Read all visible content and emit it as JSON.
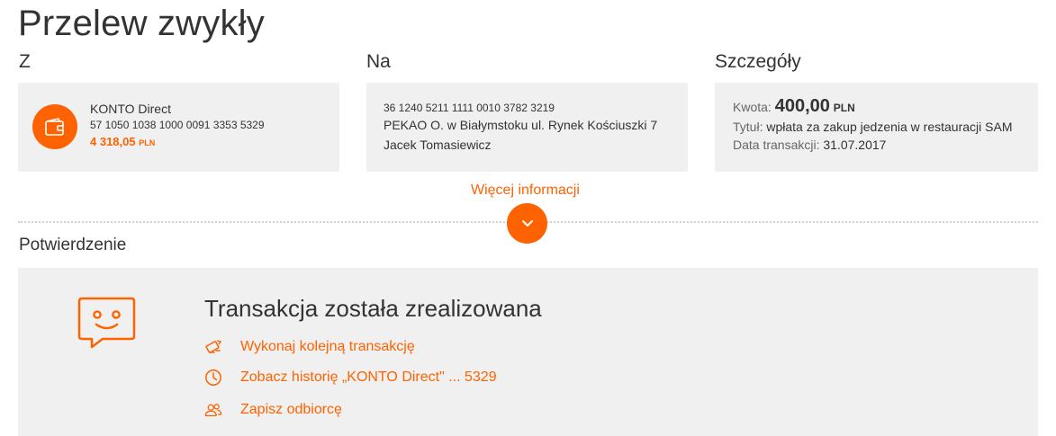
{
  "page": {
    "title": "Przelew zwykły"
  },
  "columns": {
    "from": "Z",
    "to": "Na",
    "details": "Szczegóły"
  },
  "from_account": {
    "name": "KONTO Direct",
    "number": "57 1050 1038 1000 0091 3353 5329",
    "balance": "4 318,05",
    "currency": "PLN",
    "icon": "wallet-icon"
  },
  "to_account": {
    "number": "36 1240 5211 1111 0010 3782 3219",
    "bank": "PEKAO O. w Białymstoku ul. Rynek Kościuszki 7",
    "name": "Jacek Tomasiewicz"
  },
  "details": {
    "amount_label": "Kwota:",
    "amount": "400,00",
    "amount_currency": "PLN",
    "title_label": "Tytuł:",
    "title": "wpłata za zakup jedzenia w restauracji SAM",
    "date_label": "Data transakcji:",
    "date": "31.07.2017"
  },
  "more_info": {
    "label": "Więcej informacji",
    "icon": "chevron-down-icon"
  },
  "confirmation": {
    "heading": "Potwierdzenie",
    "title": "Transakcja została zrealizowana",
    "icon": "smiley-chat-icon",
    "actions": [
      {
        "label": "Wykonaj kolejną transakcję",
        "icon": "transfer-icon"
      },
      {
        "label": "Zobacz historię „KONTO Direct\" ... 5329",
        "icon": "clock-icon"
      },
      {
        "label": "Zapisz odbiorcę",
        "icon": "people-icon"
      }
    ]
  },
  "colors": {
    "accent": "#ff6200",
    "card_bg": "#f0f0f0",
    "text": "#333333"
  }
}
